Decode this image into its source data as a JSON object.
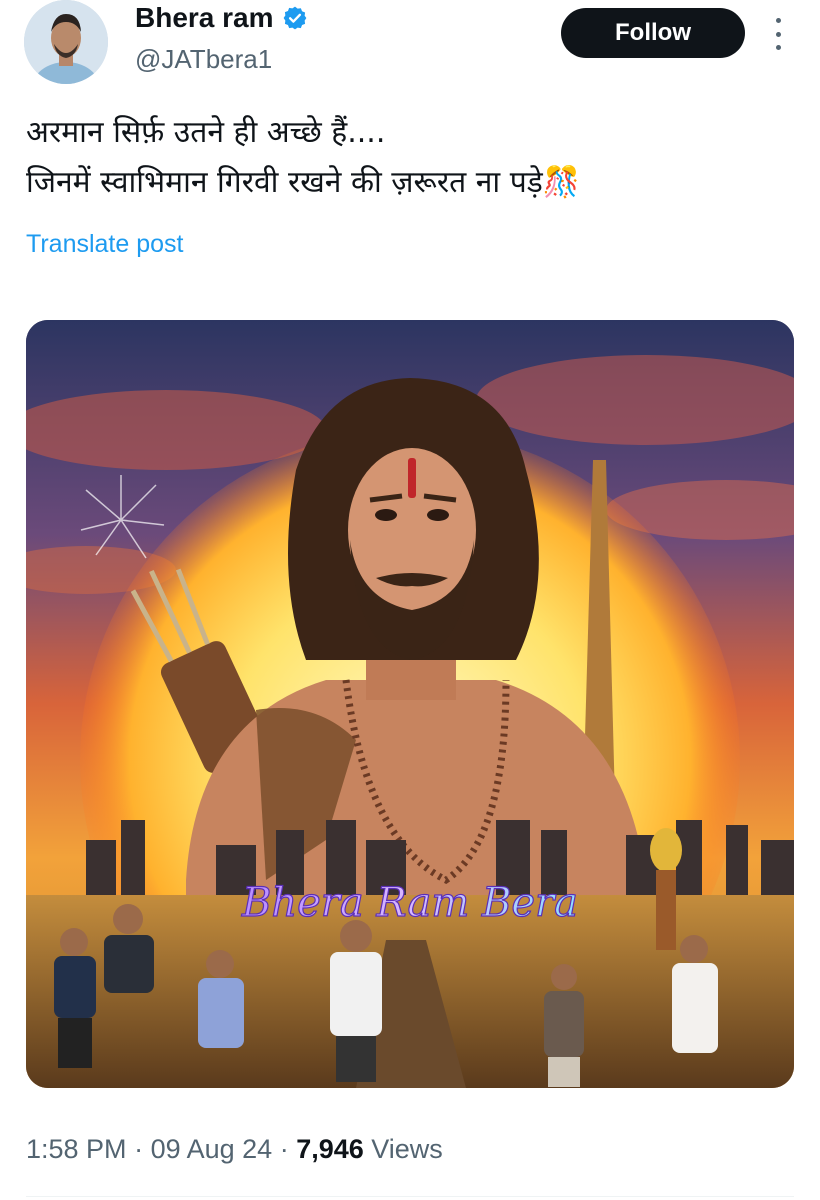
{
  "user": {
    "name": "Bhera ram",
    "handle": "@JATbera1",
    "verified": true
  },
  "follow_label": "Follow",
  "post": {
    "lines": [
      "अरमान सिर्फ़ उतने ही अच्छे हैं....",
      "जिनमें स्वाभिमान गिरवी रखने की ज़रूरत ना पड़े🎊"
    ],
    "translate_label": "Translate post"
  },
  "media": {
    "overlay_text": "Bhera Ram Bera",
    "description_icon": "poster-image"
  },
  "meta": {
    "time": "1:58 PM",
    "sep1": " · ",
    "date": "09 Aug 24",
    "sep2": " · ",
    "views_count": "7,946",
    "views_label": " Views"
  },
  "colors": {
    "accent": "#1d9bf0",
    "text": "#0f1419",
    "muted": "#536471",
    "button_bg": "#0f1419"
  }
}
